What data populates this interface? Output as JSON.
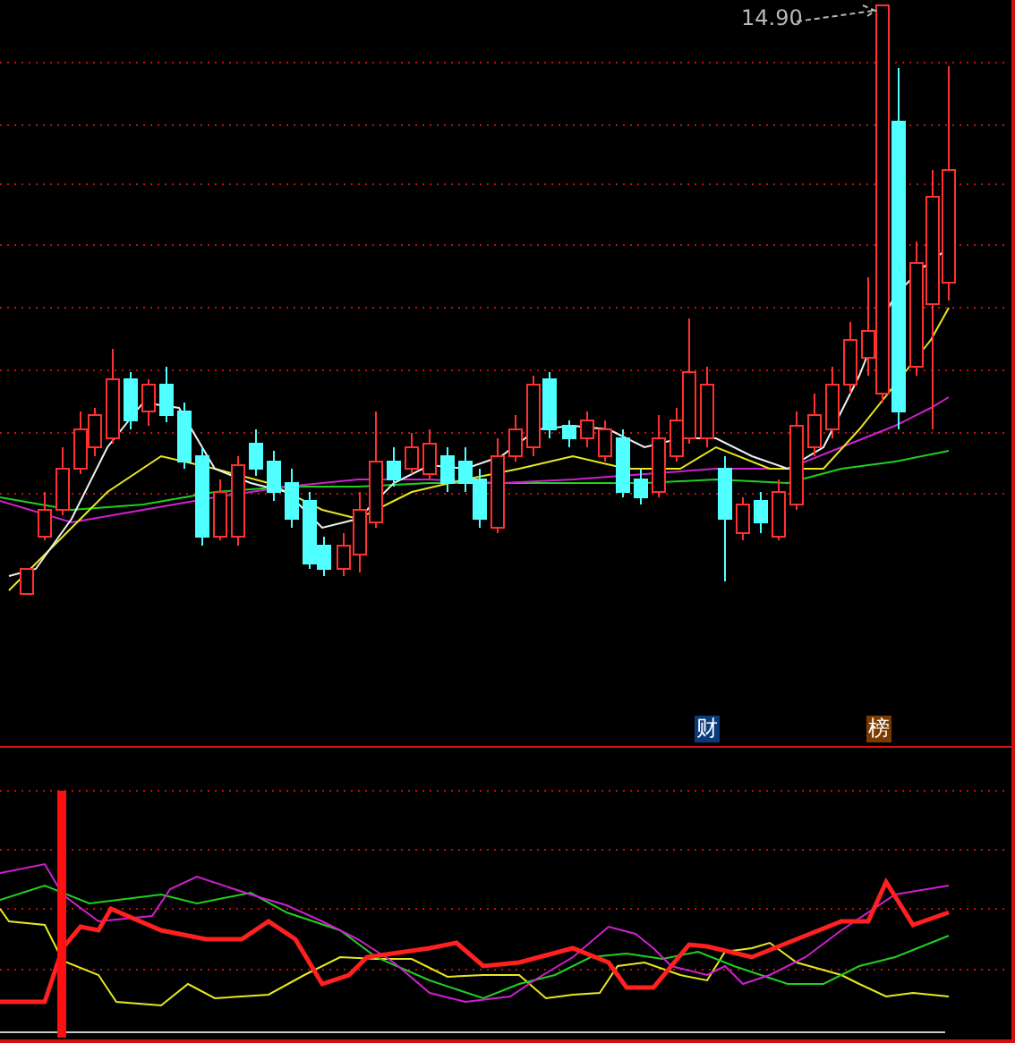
{
  "price_chart": {
    "high_label": "14.90",
    "markers": [
      {
        "text": "财",
        "color": "#0a3a78"
      },
      {
        "text": "榜",
        "color": "#7a3a00"
      }
    ]
  }
}
